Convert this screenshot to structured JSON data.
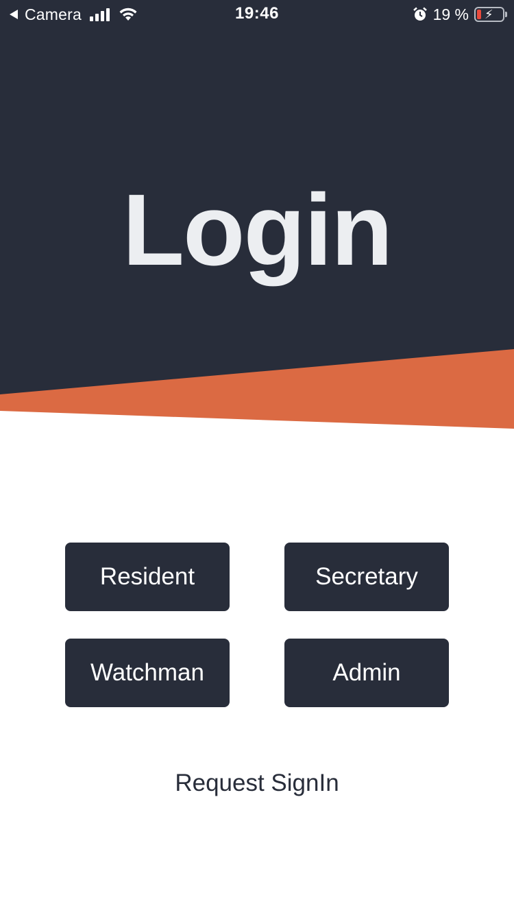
{
  "status_bar": {
    "carrier": "Camera",
    "time": "19:46",
    "battery_percent": "19 %",
    "icons": [
      "back-arrow-icon",
      "signal-icon",
      "wifi-icon",
      "alarm-icon",
      "battery-charging-icon"
    ]
  },
  "title": "Login",
  "roles": {
    "resident": "Resident",
    "secretary": "Secretary",
    "watchman": "Watchman",
    "admin": "Admin"
  },
  "request_signin": "Request SignIn",
  "colors": {
    "header_bg": "#282d3a",
    "accent": "#db6a43",
    "title_text": "#eceef1",
    "button_bg": "#282d3a",
    "button_text": "#ffffff",
    "page_bg": "#ffffff"
  }
}
